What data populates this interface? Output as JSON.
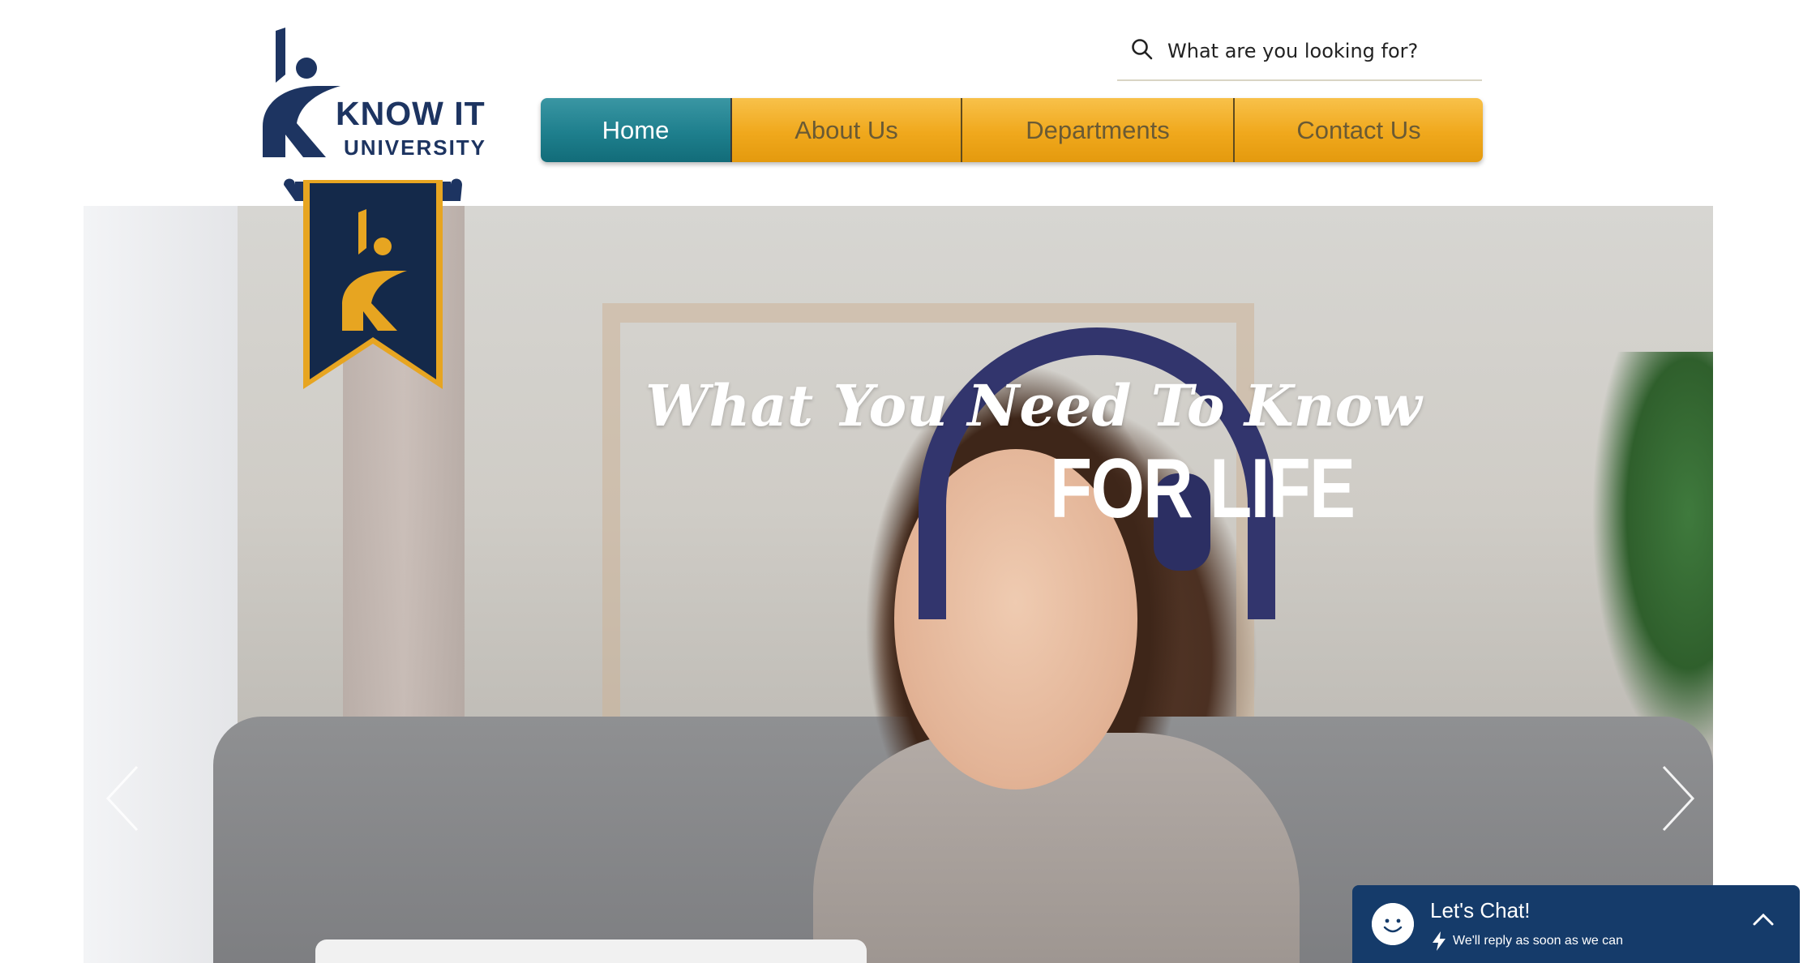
{
  "logo": {
    "line1": "KNOW IT",
    "line2": "UNIVERSITY",
    "icon": "k-figure-logo-icon"
  },
  "search": {
    "placeholder": "What are you looking for?",
    "icon": "search-icon"
  },
  "nav": {
    "items": [
      {
        "label": "Home",
        "active": true
      },
      {
        "label": "About Us",
        "active": false
      },
      {
        "label": "Departments",
        "active": false
      },
      {
        "label": "Contact Us",
        "active": false
      }
    ]
  },
  "hero": {
    "script_text": "What You Need To Know",
    "big_text": "FOR LIFE",
    "prev_icon": "chevron-left-icon",
    "next_icon": "chevron-right-icon"
  },
  "chat": {
    "title": "Let's Chat!",
    "subtitle": "We'll reply as soon as we can",
    "avatar_icon": "smiley-icon",
    "bolt_icon": "lightning-icon",
    "toggle_icon": "chevron-up-icon"
  },
  "colors": {
    "brand_navy": "#1d3461",
    "nav_gold": "#f0a81c",
    "nav_active_teal": "#1e7f8d",
    "chat_bg": "#153b6a",
    "ribbon_gold": "#e7a521"
  }
}
